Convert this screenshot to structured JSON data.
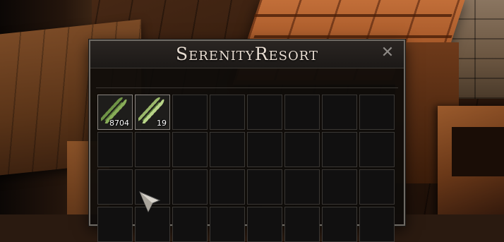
{
  "window": {
    "title": "SerenityResort",
    "close_glyph": "✕"
  },
  "inventory": {
    "columns": 8,
    "visible_rows": 4,
    "slots": [
      {
        "item": "herb-sprig-icon",
        "quantity": "8704"
      },
      {
        "item": "herb-sprig-icon",
        "quantity": "19"
      }
    ]
  },
  "colors": {
    "window_bg": "#0e0c0a",
    "border": "#6e6a64",
    "title_text": "#e8ddd2"
  }
}
